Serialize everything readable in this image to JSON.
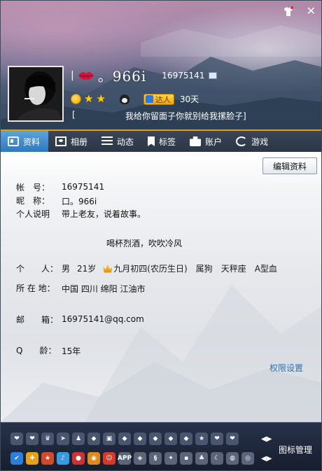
{
  "window": {
    "close_glyph": "✕"
  },
  "profile": {
    "nickname": "。966i",
    "qq_number": "16975141",
    "days_badge": "达人",
    "days": "30天",
    "signature_bracket": "[",
    "signature": "我给你留面子你就别给我摞脸子]"
  },
  "tabs": [
    {
      "label": "资料",
      "icon": "profile-card-icon"
    },
    {
      "label": "相册",
      "icon": "photo-icon"
    },
    {
      "label": "动态",
      "icon": "list-icon"
    },
    {
      "label": "标签",
      "icon": "bookmark-icon"
    },
    {
      "label": "账户",
      "icon": "wallet-icon"
    },
    {
      "label": "游戏",
      "icon": "game-icon"
    }
  ],
  "content": {
    "edit_button": "编辑资料",
    "account_label": "帐　号：",
    "account_value": "16975141",
    "nick_label": "昵　称：",
    "nick_value": "口。966i",
    "desc_label": "个人说明",
    "desc_value": "带上老友，说着故事。",
    "quote": "喝杯烈酒，吹吹冷风",
    "person_label": "个　　人：",
    "gender": "男",
    "age": "21岁",
    "birthday": "九月初四(农历生日)",
    "zodiac": "属狗",
    "constellation": "天秤座",
    "blood": "A型血",
    "location_label": "所 在 地：",
    "location_value": "中国 四川 绵阳 江油市",
    "email_label": "邮　　箱：",
    "email_value": "16975141@qq.com",
    "qage_label": "Q　　龄：",
    "qage_value": "15年",
    "permission_link": "权限设置"
  },
  "bottom": {
    "icon_manage": "图标管理",
    "app_badge": "APP",
    "arrows": "◀▶"
  },
  "colors": {
    "tab_active": "#3a86cc",
    "tab_bar": "#2f3a4b",
    "accent_line": "#e0a000",
    "link": "#2f6fb5"
  }
}
